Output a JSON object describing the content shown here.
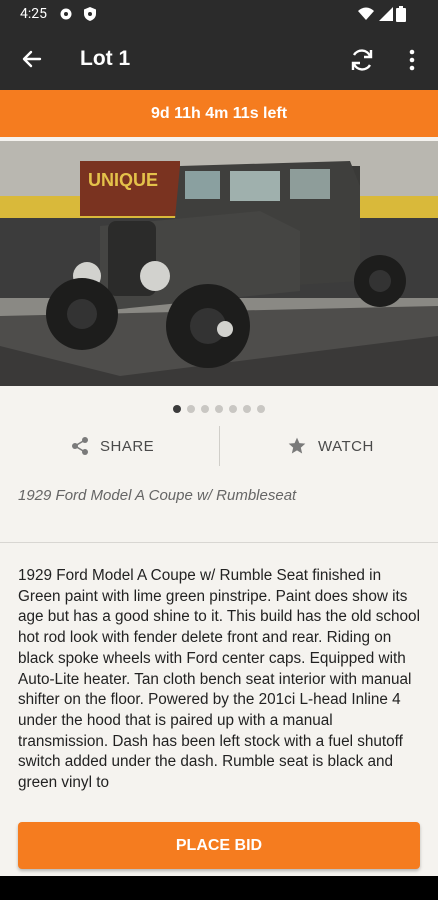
{
  "status_bar": {
    "time": "4:25"
  },
  "app_bar": {
    "title": "Lot 1"
  },
  "timer": {
    "text": "9d 11h 4m 11s left"
  },
  "carousel": {
    "count": 7,
    "active": 1,
    "sign_text": "UNIQUE"
  },
  "actions": {
    "share_label": "SHARE",
    "watch_label": "WATCH"
  },
  "lot": {
    "subtitle": "1929 Ford Model A Coupe w/ Rumbleseat",
    "description": "1929 Ford Model A Coupe w/ Rumble Seat finished in Green paint with lime green pinstripe. Paint does show its age but has a good shine to it. This build has the old school hot rod look with fender delete front and rear. Riding on black spoke wheels with Ford center caps. Equipped with Auto-Lite heater. Tan cloth bench seat interior with manual shifter on the floor. Powered by the 201ci L-head Inline 4 under the hood that is paired up with a manual transmission. Dash has been left stock with a fuel shutoff switch added under the dash. Rumble seat is black and green vinyl to"
  },
  "place_bid_label": "PLACE BID",
  "colors": {
    "accent": "#f57c1f",
    "appbar": "#2b2b2b",
    "background": "#f5f3ef"
  }
}
